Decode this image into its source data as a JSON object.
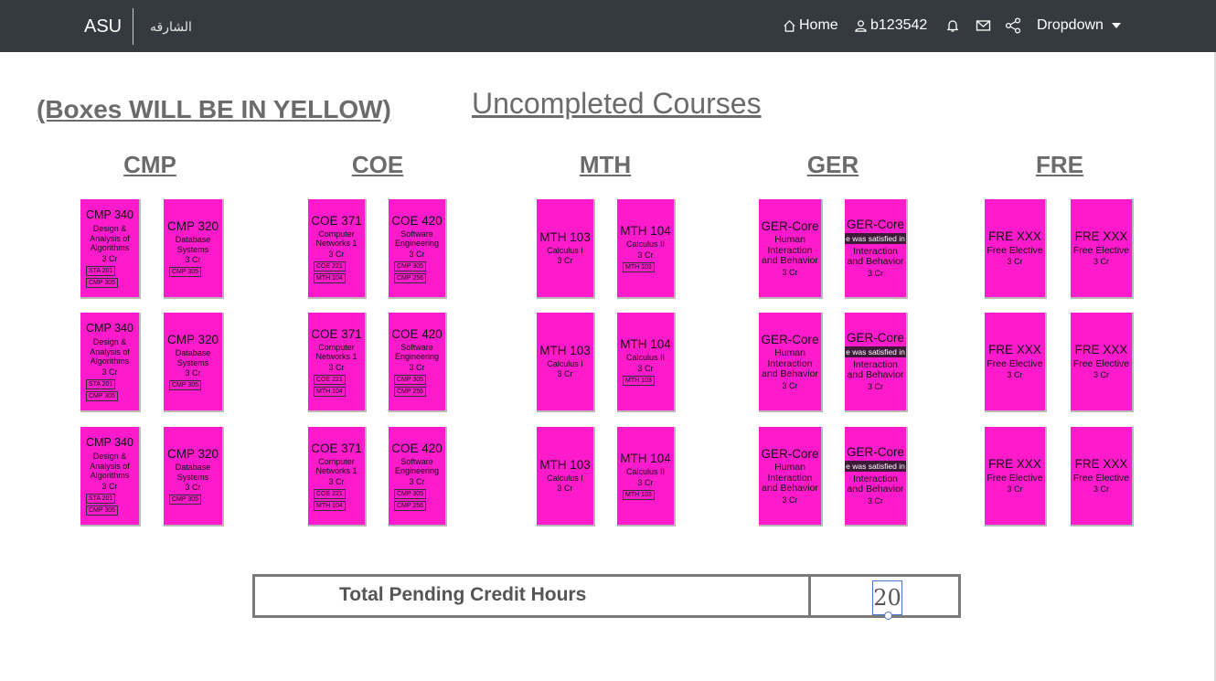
{
  "header": {
    "brand": "ASU",
    "brand_arabic": "الشارقه",
    "nav": {
      "home": "Home",
      "user": "b123542",
      "dropdown": "Dropdown"
    }
  },
  "note": "(Boxes WILL BE IN YELLOW)",
  "title": "Uncompleted Courses",
  "groups": [
    "CMP",
    "COE",
    "MTH",
    "GER",
    "FRE"
  ],
  "courses": {
    "cmp340": {
      "code": "CMP 340",
      "name": "Design & Analysis of Algorithms",
      "credits": "3 Cr",
      "prereqs": [
        "STA 201",
        "CMP 305"
      ]
    },
    "cmp320": {
      "code": "CMP 320",
      "name": "Database Systems",
      "credits": "3 Cr",
      "prereqs": [
        "CMP 305"
      ]
    },
    "coe371": {
      "code": "COE 371",
      "name": "Computer Networks 1",
      "credits": "3 Cr",
      "prereqs": [
        "COE 221",
        "MTH 104"
      ]
    },
    "coe420": {
      "code": "COE 420",
      "name": "Software Engineering",
      "credits": "3 Cr",
      "prereqs": [
        "CMP 305",
        "CMP 256"
      ]
    },
    "mth103": {
      "code": "MTH 103",
      "name": "Calculus I",
      "credits": "3 Cr",
      "prereqs": []
    },
    "mth104": {
      "code": "MTH 104",
      "name": "Calculus II",
      "credits": "3 Cr",
      "prereqs": [
        "MTH 103"
      ]
    },
    "ger1": {
      "code": "GER-Core",
      "name": "Human Interaction and Behavior",
      "credits": "3 Cr",
      "tooltip": ""
    },
    "ger2": {
      "code": "GER-Core",
      "name": "Interaction and Behavior",
      "credits": "3 Cr",
      "tooltip": "e was satisfied in"
    },
    "fre": {
      "code": "FRE XXX",
      "name": "Free Elective",
      "credits": "3 Cr",
      "prereqs": []
    }
  },
  "total": {
    "label": "Total Pending Credit Hours",
    "value": "20"
  },
  "colors": {
    "card": "#ff1acb",
    "topbar": "#343a40",
    "heading": "#6b6b6b"
  }
}
